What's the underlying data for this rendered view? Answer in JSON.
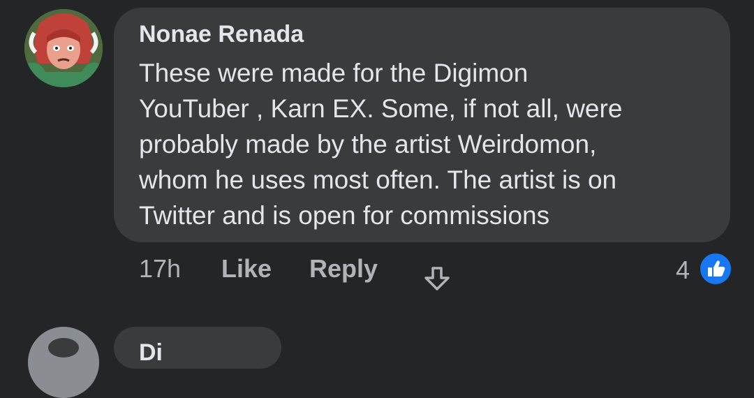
{
  "comment": {
    "author": "Nonae Renada",
    "text_lines": [
      "These were made for the Digimon",
      "YouTuber , Karn EX. Some, if not all, were",
      "probably made by the artist Weirdomon,",
      "whom he uses most often. The artist is on",
      "Twitter and is open for commissions"
    ],
    "timestamp": "17h",
    "like_label": "Like",
    "reply_label": "Reply",
    "share_icon": "share-arrow-icon",
    "reaction_count": "4",
    "reaction_icon": "thumbs-up-icon"
  },
  "next_comment": {
    "author": "Di"
  },
  "colors": {
    "background": "#242526",
    "bubble": "#3a3b3c",
    "text_primary": "#e4e6eb",
    "text_secondary": "#b0b3b8",
    "like_blue": "#1877f2"
  }
}
